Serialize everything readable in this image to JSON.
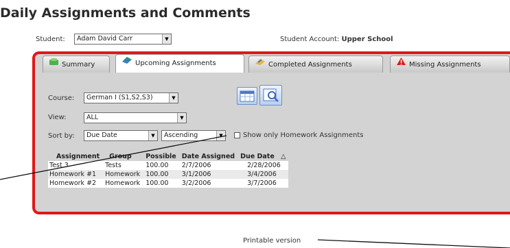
{
  "page": {
    "title": "Daily Assignments and Comments"
  },
  "student": {
    "label": "Student:",
    "value": "Adam David Carr",
    "account_label": "Student Account:",
    "account_value": "Upper School"
  },
  "tabs": [
    {
      "label": "Summary",
      "icon": "summary-icon"
    },
    {
      "label": "Upcoming Assignments",
      "icon": "upcoming-icon"
    },
    {
      "label": "Completed Assignments",
      "icon": "completed-icon"
    },
    {
      "label": "Missing Assignments",
      "icon": "warning-icon"
    }
  ],
  "filters": {
    "course_label": "Course:",
    "course_value": "German I (S1,S2,S3)",
    "view_label": "View:",
    "view_value": "ALL",
    "sort_label": "Sort by:",
    "sort_value": "Due Date",
    "order_value": "Ascending",
    "homework_only_label": "Show only Homework Assignments"
  },
  "table": {
    "headers": [
      "Assignment",
      "Group",
      "Possible",
      "Date Assigned",
      "Due Date"
    ],
    "sort_indicator": "△",
    "rows": [
      [
        "Test 3",
        "Tests",
        "100.00",
        "2/7/2006",
        "2/28/2006"
      ],
      [
        "Homework #1",
        "Homework",
        "100.00",
        "3/1/2006",
        "3/4/2006"
      ],
      [
        "Homework #2",
        "Homework",
        "100.00",
        "3/2/2006",
        "3/7/2006"
      ]
    ]
  },
  "footer": {
    "printable": "Printable version"
  },
  "colors": {
    "panel_border": "#e01818",
    "panel_bg": "#d3d3d3"
  }
}
